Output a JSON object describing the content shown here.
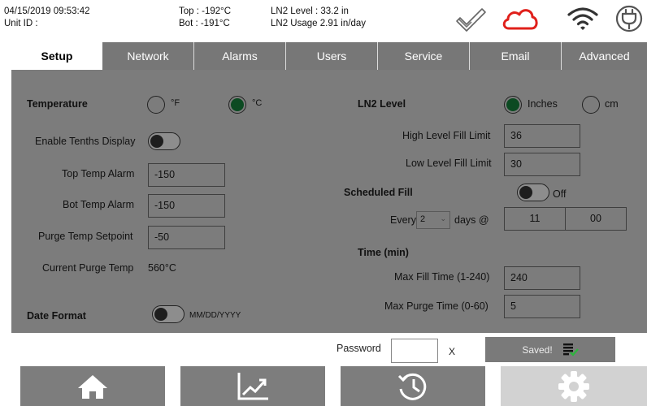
{
  "status": {
    "datetime": "04/15/2019 09:53:42",
    "unit_id_label": "Unit ID :",
    "top_temp": "Top : -192°C",
    "bot_temp": "Bot : -191°C",
    "ln2_level": "LN2 Level : 33.2 in",
    "ln2_usage": "LN2 Usage  2.91 in/day",
    "icons": [
      "checkmark-icon",
      "cloud-icon",
      "wifi-icon",
      "power-plug-icon"
    ],
    "cloud_color": "#e0201b"
  },
  "tabs": [
    {
      "label": "Setup",
      "active": true
    },
    {
      "label": "Network",
      "active": false
    },
    {
      "label": "Alarms",
      "active": false
    },
    {
      "label": "Users",
      "active": false
    },
    {
      "label": "Service",
      "active": false
    },
    {
      "label": "Email",
      "active": false
    },
    {
      "label": "Advanced",
      "active": false
    }
  ],
  "setup": {
    "temperature_label": "Temperature",
    "unit_f": "°F",
    "unit_c": "°C",
    "unit_selected": "°C",
    "tenths_label": "Enable Tenths Display",
    "tenths_on": false,
    "top_alarm_label": "Top Temp Alarm",
    "top_alarm_value": "-150",
    "bot_alarm_label": "Bot Temp Alarm",
    "bot_alarm_value": "-150",
    "purge_setpoint_label": "Purge Temp Setpoint",
    "purge_setpoint_value": "-50",
    "current_purge_label": "Current Purge Temp",
    "current_purge_value": "560°C",
    "date_format_label": "Date Format",
    "date_format_value": "MM/DD/YYYY",
    "ln2_level_label": "LN2 Level",
    "unit_inches": "Inches",
    "unit_cm": "cm",
    "level_unit_selected": "Inches",
    "high_limit_label": "High Level Fill Limit",
    "high_limit_value": "36",
    "low_limit_label": "Low Level Fill Limit",
    "low_limit_value": "30",
    "scheduled_fill_label": "Scheduled Fill",
    "scheduled_state": "Off",
    "every_label": "Every",
    "every_value": "2",
    "days_at_label": "days @",
    "hour_value": "11",
    "minute_value": "00",
    "time_label": "Time (min)",
    "max_fill_label": "Max Fill Time (1-240)",
    "max_fill_value": "240",
    "max_purge_label": "Max Purge Time (0-60)",
    "max_purge_value": "5"
  },
  "footer": {
    "password_label": "Password",
    "clear_label": "X",
    "saved_label": "Saved!"
  },
  "nav": [
    {
      "icon": "home-icon",
      "active": false
    },
    {
      "icon": "trend-chart-icon",
      "active": false
    },
    {
      "icon": "history-clock-icon",
      "active": false
    },
    {
      "icon": "settings-gear-icon",
      "active": true
    }
  ]
}
